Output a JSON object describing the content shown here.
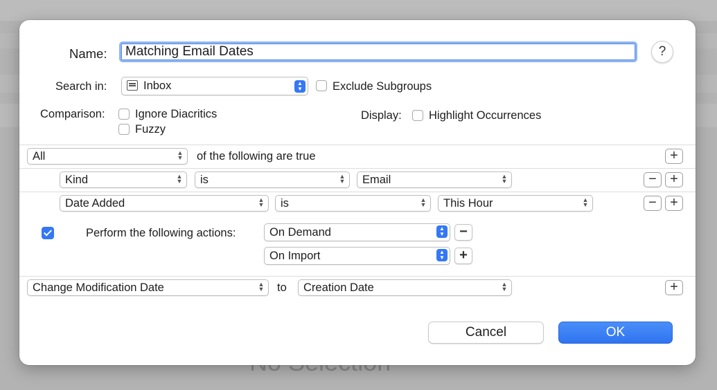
{
  "background": {
    "text": "No Selection"
  },
  "name": {
    "label": "Name:",
    "value": "Matching Email Dates"
  },
  "help": {
    "glyph": "?"
  },
  "search_in": {
    "label": "Search in:",
    "value": "Inbox",
    "icon": "inbox-icon"
  },
  "exclude_subgroups": {
    "label": "Exclude Subgroups",
    "checked": false
  },
  "comparison": {
    "label": "Comparison:",
    "options": [
      {
        "label": "Ignore Diacritics",
        "checked": false
      },
      {
        "label": "Fuzzy",
        "checked": false
      }
    ]
  },
  "display": {
    "label": "Display:",
    "option": {
      "label": "Highlight Occurrences",
      "checked": false
    }
  },
  "match": {
    "value": "All",
    "suffix": "of the following are true"
  },
  "conditions": [
    {
      "field": "Kind",
      "operator": "is",
      "value": "Email"
    },
    {
      "field": "Date Added",
      "operator": "is",
      "value": "This Hour"
    }
  ],
  "actions": {
    "label": "Perform the following actions:",
    "enabled": true,
    "triggers": [
      "On Demand",
      "On Import"
    ]
  },
  "action_row": {
    "action": "Change Modification Date",
    "to_label": "to",
    "value": "Creation Date"
  },
  "buttons": {
    "cancel": "Cancel",
    "ok": "OK",
    "plus": "+",
    "minus": "−"
  },
  "colors": {
    "accent": "#3478f6"
  }
}
